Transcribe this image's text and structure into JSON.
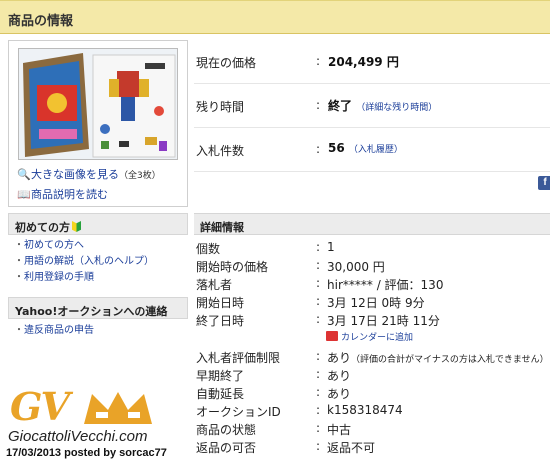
{
  "header": {
    "title": "商品の情報"
  },
  "left": {
    "image_link": "大きな画像を見る",
    "image_count": "（全3枚）",
    "desc_link": "商品説明を読む",
    "beginner": {
      "title": "初めての方",
      "items": [
        "初めての方へ",
        "用語の解説（入札のヘルプ）",
        "利用登録の手順"
      ]
    },
    "contact": {
      "title": "Yahoo!オークションへの連絡",
      "items": [
        "違反商品の申告"
      ]
    }
  },
  "price": {
    "current_label": "現在の価格",
    "current_value": "204,499 円",
    "remaining_label": "残り時間",
    "remaining_value": "終了",
    "remaining_link": "（詳細な残り時間）",
    "bids_label": "入札件数",
    "bids_value": "56",
    "bids_link": "（入札履歴）"
  },
  "details": {
    "title": "詳細情報",
    "rows": [
      {
        "label": "個数",
        "value": "1"
      },
      {
        "label": "開始時の価格",
        "value": "30,000 円"
      },
      {
        "label": "落札者",
        "value": "hir***** / 評価：130"
      },
      {
        "label": "開始日時",
        "value": "3月 12日 0時 9分"
      },
      {
        "label": "終了日時",
        "value": "3月 17日 21時 11分"
      }
    ],
    "calendar_link": "カレンダーに追加",
    "rows2": [
      {
        "label": "入札者評価制限",
        "value": "あり",
        "note": "（評価の合計がマイナスの方は入札できません）"
      },
      {
        "label": "早期終了",
        "value": "あり"
      },
      {
        "label": "自動延長",
        "value": "あり"
      },
      {
        "label": "オークションID",
        "value": "k158318474"
      },
      {
        "label": "商品の状態",
        "value": "中古"
      },
      {
        "label": "返品の可否",
        "value": "返品不可"
      }
    ]
  },
  "social": {
    "fb_icon": "facebook-icon",
    "fb_glyph": "f"
  },
  "watermark": {
    "logo": "GV",
    "site": "GiocattoliVecchi.com",
    "posted": "17/03/2013 posted by sorcac77"
  }
}
